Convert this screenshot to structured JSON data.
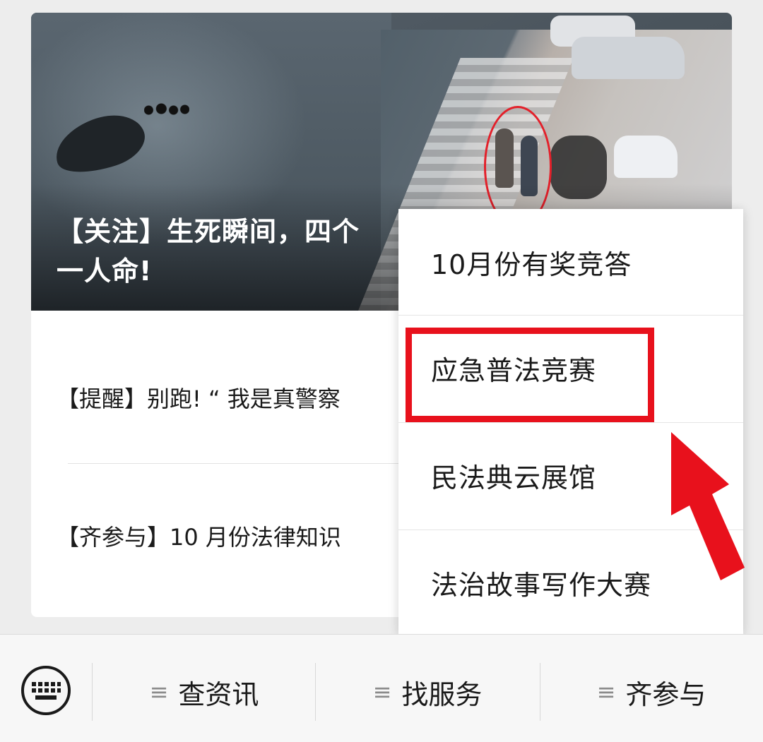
{
  "article": {
    "headline": "【关注】生死瞬间，四个\n一人命!",
    "items": [
      {
        "text": "【提醒】别跑! “ 我是真警察"
      },
      {
        "text": "【齐参与】10 月份法律知识"
      }
    ]
  },
  "popup_menu": {
    "items": [
      {
        "label": "10月份有奖竞答"
      },
      {
        "label": "应急普法竞赛",
        "highlighted": true
      },
      {
        "label": "民法典云展馆"
      },
      {
        "label": "法治故事写作大赛"
      }
    ]
  },
  "bottom_nav": {
    "keyboard_icon": "keyboard-icon",
    "tabs": [
      {
        "label": "查资讯",
        "icon": "menu-lines-icon"
      },
      {
        "label": "找服务",
        "icon": "menu-lines-icon"
      },
      {
        "label": "齐参与",
        "icon": "menu-lines-icon"
      }
    ]
  },
  "annotation": {
    "box_color": "#e8111c",
    "arrow_color": "#e8111c"
  }
}
